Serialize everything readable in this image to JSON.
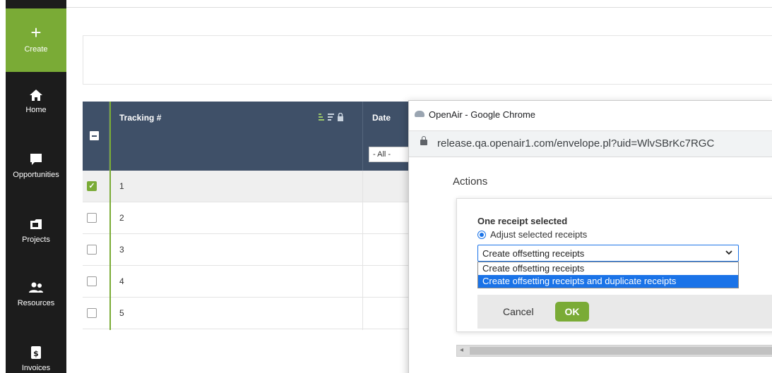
{
  "sidebar": {
    "create_label": "Create",
    "create_symbol": "+",
    "items": [
      {
        "label": "Home",
        "icon": "home-icon"
      },
      {
        "label": "Opportunities",
        "icon": "chat-bubble-icon"
      },
      {
        "label": "Projects",
        "icon": "folder-icon"
      },
      {
        "label": "Resources",
        "icon": "people-icon"
      },
      {
        "label": "Invoices",
        "icon": "dollar-doc-icon"
      }
    ],
    "accent": "#7aab36",
    "bg": "#1c1c1c"
  },
  "grid": {
    "header": {
      "tracking": "Tracking #",
      "date": "Date",
      "date_filter": "- All -",
      "icons": "sort-filter-lock-icons"
    },
    "rows": [
      {
        "num": "1",
        "selected": true
      },
      {
        "num": "2",
        "selected": false
      },
      {
        "num": "3",
        "selected": false
      },
      {
        "num": "4",
        "selected": false
      },
      {
        "num": "5",
        "selected": false
      }
    ],
    "check_mark": "✓",
    "header_bg": "#3f5068"
  },
  "popup": {
    "window_title": "OpenAir - Google Chrome",
    "url": "release.qa.openair1.com/envelope.pl?uid=WlvSBrKc7RGC",
    "actions_title": "Actions",
    "selection_text": "One receipt selected",
    "radio_label": "Adjust selected receipts",
    "select_value": "Create offsetting receipts",
    "chevron": "⌄",
    "options": [
      "Create offsetting receipts",
      "Create offsetting receipts and duplicate receipts"
    ],
    "highlighted_option_index": 1,
    "cancel_label": "Cancel",
    "ok_label": "OK",
    "scroll_arrow": "◂"
  }
}
